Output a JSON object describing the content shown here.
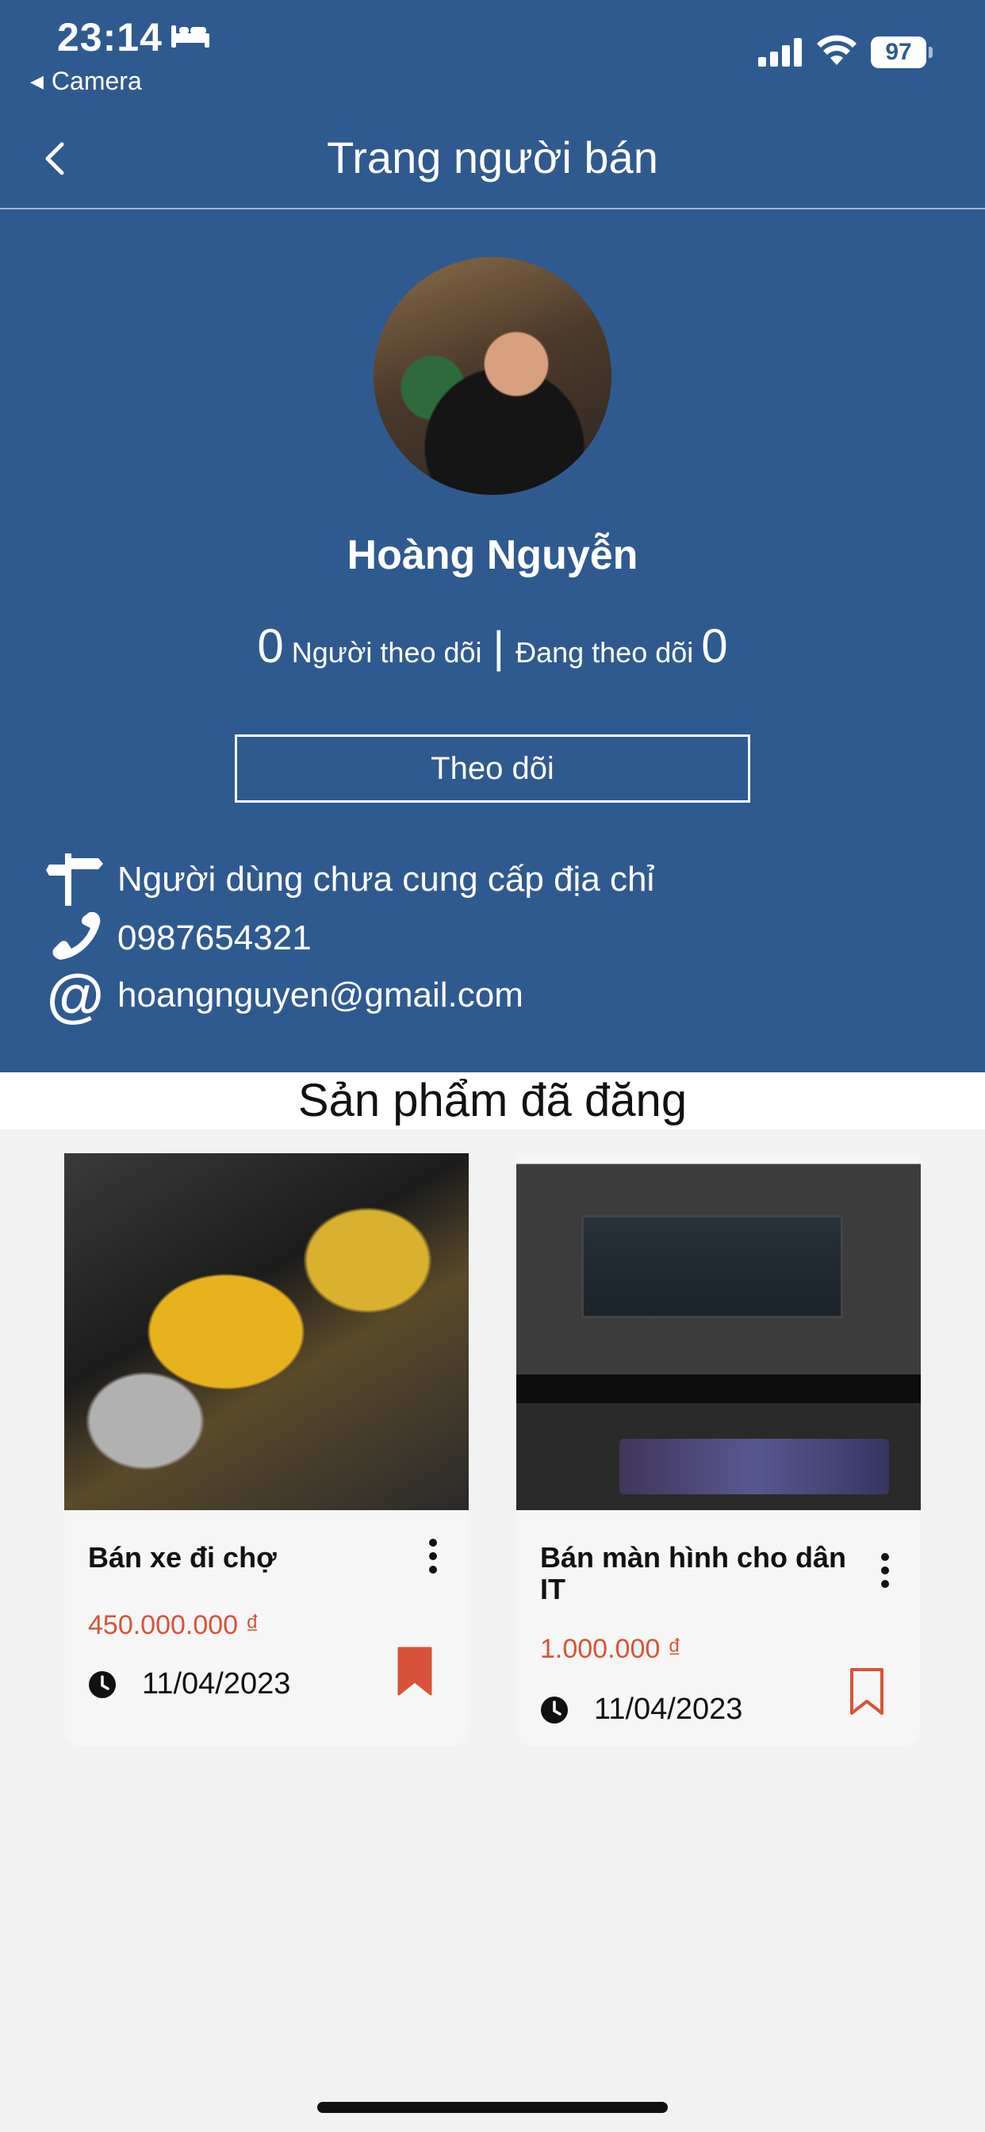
{
  "status_bar": {
    "time": "23:14",
    "back_app": "Camera",
    "battery": "97"
  },
  "navbar": {
    "title": "Trang người bán",
    "back_icon": "chevron-left-icon"
  },
  "profile": {
    "name": "Hoàng  Nguyễn",
    "followers_count": "0",
    "followers_label": "Người theo dõi",
    "following_label": "Đang theo dõi",
    "following_count": "0",
    "follow_button": "Theo dõi",
    "address": "Người dùng chưa cung cấp địa chỉ",
    "phone": "0987654321",
    "email": "hoangnguyen@gmail.com"
  },
  "products_section": {
    "title": "Sản phẩm đã đăng",
    "items": [
      {
        "title": "Bán xe đi chợ",
        "price": "450.000.000 ₫",
        "date": "11/04/2023",
        "bookmarked": true
      },
      {
        "title": "Bán màn hình cho dân IT",
        "price": "1.000.000 ₫",
        "date": "11/04/2023",
        "bookmarked": false
      }
    ]
  },
  "colors": {
    "header_bg": "#2f5a90",
    "price": "#d9533a",
    "bookmark": "#d9533a",
    "page_bg": "#f2f2f2"
  }
}
